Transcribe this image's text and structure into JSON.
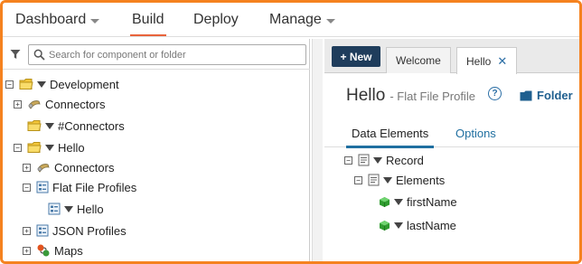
{
  "nav": {
    "dashboard": "Dashboard",
    "build": "Build",
    "deploy": "Deploy",
    "manage": "Manage"
  },
  "search": {
    "placeholder": "Search for component or folder"
  },
  "tree": {
    "development": "Development",
    "connectors_1": "Connectors",
    "hash_connectors": "#Connectors",
    "hello_folder": "Hello",
    "connectors_2": "Connectors",
    "flat_file_profiles": "Flat File Profiles",
    "hello_profile": "Hello",
    "json_profiles": "JSON Profiles",
    "maps": "Maps"
  },
  "tabs": {
    "new_label": "+ New",
    "welcome": "Welcome",
    "hello": "Hello",
    "close": "✕"
  },
  "component": {
    "name": "Hello",
    "type_label": "- Flat File Profile",
    "help": "?",
    "folder_label": "Folder"
  },
  "subtabs": {
    "data_elements": "Data Elements",
    "options": "Options"
  },
  "profile_tree": {
    "record": "Record",
    "elements": "Elements",
    "first_name": "firstName",
    "last_name": "lastName"
  },
  "colors": {
    "accent_orange": "#f5821f",
    "nav_underline": "#e8643c",
    "new_button": "#1f3d5c",
    "link_blue": "#1f6fa0",
    "field_green": "#2e9b2e"
  },
  "icons": {
    "filter": "filter-icon",
    "folder": "folder-icon",
    "connector": "connector-icon",
    "profile": "profile-icon",
    "map": "map-icon",
    "record": "record-icon",
    "field": "field-cube-icon"
  }
}
